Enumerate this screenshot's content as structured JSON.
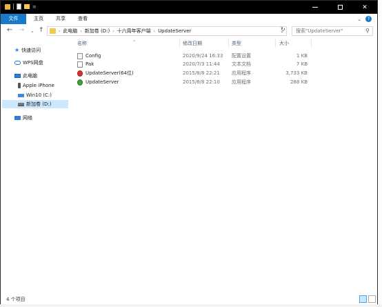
{
  "ribbon": {
    "tabs": [
      "文件",
      "主页",
      "共享",
      "查看"
    ]
  },
  "address": {
    "breadcrumbs": [
      "此电脑",
      "新加卷 (D:)",
      "十六周年客户端",
      "UpdateServer"
    ]
  },
  "search": {
    "placeholder": "搜索\"UpdateServer\""
  },
  "nav": {
    "quick_access": "快速访问",
    "wps": "WPS网盘",
    "this_pc": "此电脑",
    "iphone": "Apple iPhone",
    "c_drive": "Win10 (C:)",
    "d_drive": "新加卷 (D:)",
    "network": "网络"
  },
  "columns": {
    "name": "名称",
    "modified": "修改日期",
    "type": "类型",
    "size": "大小"
  },
  "files": [
    {
      "name": "Config",
      "modified": "2020/9/24 16:33",
      "type": "配置设置",
      "size": "1 KB",
      "icon": "config-file-icon"
    },
    {
      "name": "Pak",
      "modified": "2020/7/3 11:44",
      "type": "文本文档",
      "size": "7 KB",
      "icon": "text-file-icon"
    },
    {
      "name": "UpdateServer(64位)",
      "modified": "2015/8/8 22:21",
      "type": "应用程序",
      "size": "3,733 KB",
      "icon": "app-red-icon"
    },
    {
      "name": "UpdateServer",
      "modified": "2015/8/8 22:10",
      "type": "应用程序",
      "size": "288 KB",
      "icon": "app-green-icon"
    }
  ],
  "status": {
    "item_count": "4 个项目"
  },
  "colors": {
    "file_tab": "#1979ca",
    "selection": "#cce8ff",
    "titlebar": "#000000"
  }
}
